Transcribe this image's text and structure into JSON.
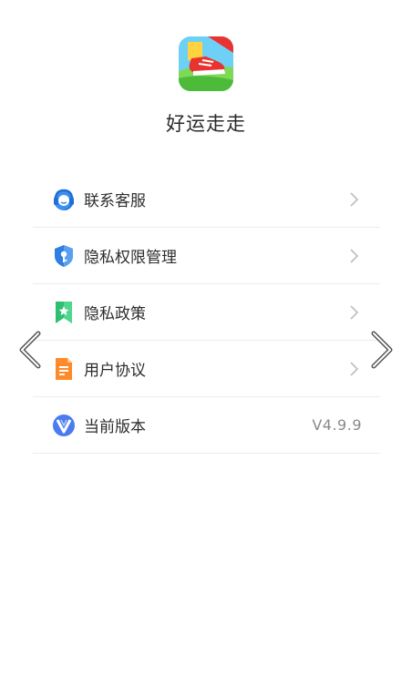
{
  "app": {
    "name": "好运走走",
    "icon": "app-logo-sneaker-icon"
  },
  "menu": {
    "items": [
      {
        "label": "联系客服",
        "icon": "customer-service-headset-icon",
        "action": "chevron-right"
      },
      {
        "label": "隐私权限管理",
        "icon": "shield-key-icon",
        "action": "chevron-right"
      },
      {
        "label": "隐私政策",
        "icon": "bookmark-star-icon",
        "action": "chevron-right"
      },
      {
        "label": "用户协议",
        "icon": "document-icon",
        "action": "chevron-right"
      },
      {
        "label": "当前版本",
        "icon": "version-v-icon",
        "value": "V4.9.9"
      }
    ]
  },
  "colors": {
    "service_blue": "#3d8ff0",
    "shield_blue": "#2f7fe0",
    "bookmark_green": "#2fbf71",
    "document_orange": "#ff8a2a",
    "version_blue": "#4a7bf0",
    "text_primary": "#2d2d2d",
    "text_secondary": "#8a8a8a",
    "chevron": "#bdbdbd"
  }
}
